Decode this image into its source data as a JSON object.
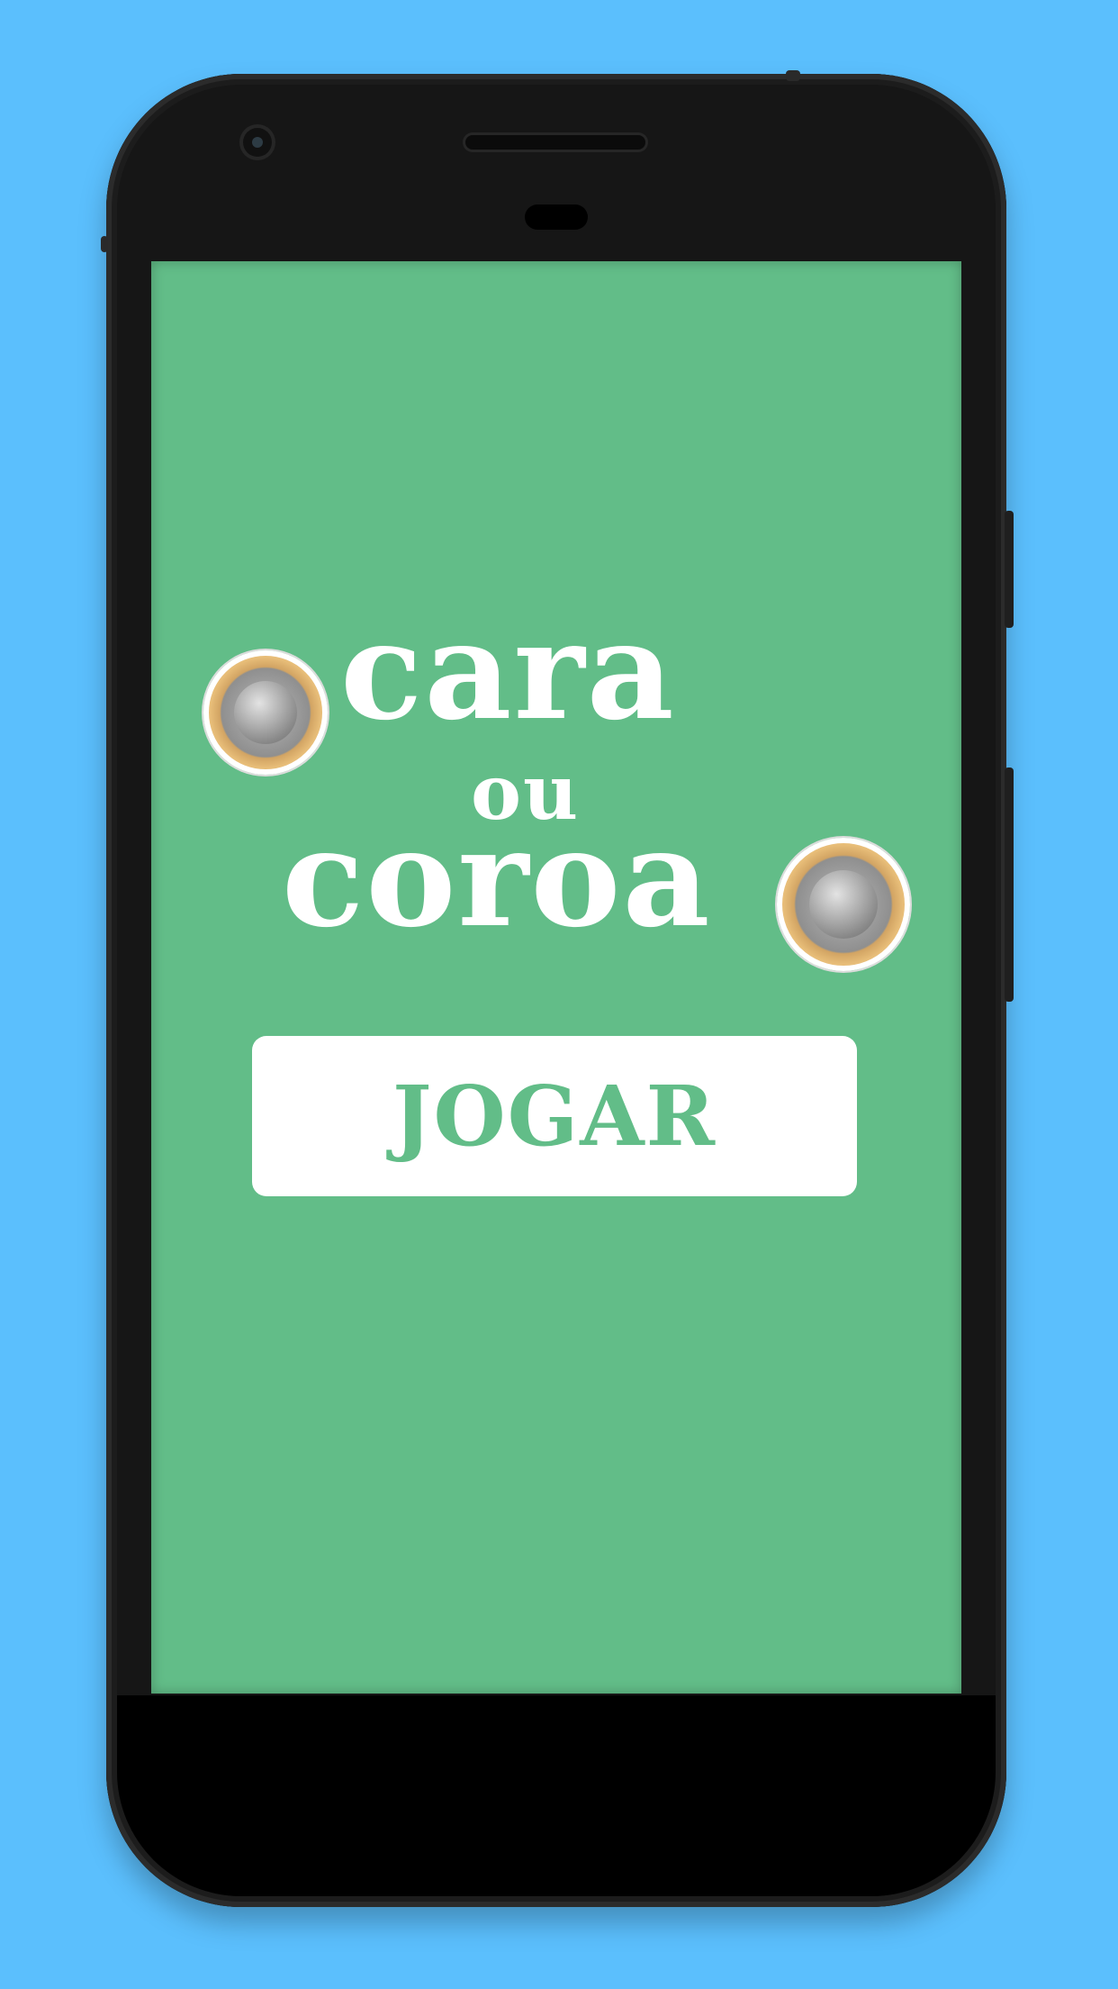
{
  "title": {
    "word1": "cara",
    "word2": "ou",
    "word3": "coroa"
  },
  "coins": {
    "left_icon": "coin-heads-icon",
    "right_icon": "coin-tails-icon"
  },
  "play_button": {
    "label": "JOGAR"
  },
  "colors": {
    "background": "#5bbffd",
    "screen": "#62bd88",
    "button_bg": "#ffffff",
    "button_text": "#62bd88",
    "title_text": "#ffffff"
  }
}
